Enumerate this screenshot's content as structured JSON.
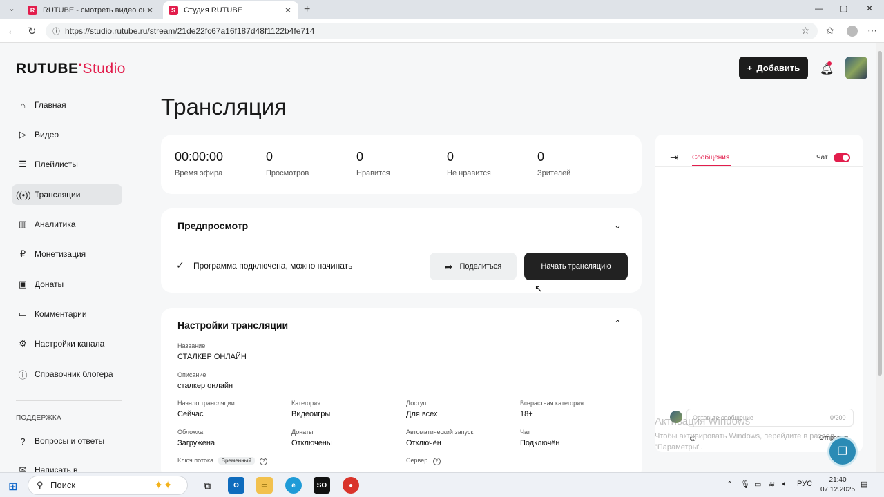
{
  "browser": {
    "tabs": [
      {
        "title": "RUTUBE - смотреть видео онлай",
        "icon": "rutube-favicon"
      },
      {
        "title": "Студия RUTUBE",
        "icon": "rutube-studio-favicon"
      }
    ],
    "url": "https://studio.rutube.ru/stream/21de22fc67a16f187d48f1122b4fe714"
  },
  "header": {
    "logo_main": "RUTUBE",
    "logo_accent": "Studio",
    "add_button": "Добавить"
  },
  "sidebar": {
    "items": [
      {
        "label": "Главная",
        "icon": "home-icon"
      },
      {
        "label": "Видео",
        "icon": "video-icon"
      },
      {
        "label": "Плейлисты",
        "icon": "playlist-icon"
      },
      {
        "label": "Трансляции",
        "icon": "broadcast-icon",
        "active": true
      },
      {
        "label": "Аналитика",
        "icon": "analytics-icon"
      },
      {
        "label": "Монетизация",
        "icon": "money-icon"
      },
      {
        "label": "Донаты",
        "icon": "wallet-icon"
      },
      {
        "label": "Комментарии",
        "icon": "comment-icon"
      },
      {
        "label": "Настройки канала",
        "icon": "gear-icon"
      },
      {
        "label": "Справочник блогера",
        "icon": "info-icon"
      }
    ],
    "support_heading": "ПОДДЕРЖКА",
    "support_items": [
      {
        "label": "Вопросы и ответы",
        "icon": "question-icon"
      },
      {
        "label": "Написать в",
        "icon": "chat-icon"
      }
    ]
  },
  "main": {
    "title": "Трансляция",
    "stats": [
      {
        "value": "00:00:00",
        "label": "Время эфира"
      },
      {
        "value": "0",
        "label": "Просмотров"
      },
      {
        "value": "0",
        "label": "Нравится"
      },
      {
        "value": "0",
        "label": "Не нравится"
      },
      {
        "value": "0",
        "label": "Зрителей"
      }
    ],
    "preview": {
      "title": "Предпросмотр",
      "status": "Программа подключена, можно начинать",
      "share_button": "Поделиться",
      "start_button": "Начать трансляцию"
    },
    "settings": {
      "title": "Настройки трансляции",
      "name_label": "Название",
      "name_value": "СТАЛКЕР ОНЛАЙН",
      "desc_label": "Описание",
      "desc_value": "сталкер онлайн",
      "fields": [
        {
          "label": "Начало трансляции",
          "value": "Сейчас"
        },
        {
          "label": "Категория",
          "value": "Видеоигры"
        },
        {
          "label": "Доступ",
          "value": "Для всех"
        },
        {
          "label": "Возрастная категория",
          "value": "18+"
        },
        {
          "label": "Обложка",
          "value": "Загружена"
        },
        {
          "label": "Донаты",
          "value": "Отключены"
        },
        {
          "label": "Автоматический запуск",
          "value": "Отключён"
        },
        {
          "label": "Чат",
          "value": "Подключён"
        }
      ],
      "stream_key_label": "Ключ потока",
      "stream_key_badge": "Временный",
      "server_label": "Сервер"
    }
  },
  "chat": {
    "tab": "Сообщения",
    "toggle_label": "Чат",
    "toggle_on": true,
    "input_placeholder": "Оставьте сообщение",
    "counter": "0/200",
    "send": "Отправить"
  },
  "watermark": {
    "line1": "Активация Windows",
    "line2": "Чтобы активировать Windows, перейдите в раздел \"Параметры\"."
  },
  "taskbar": {
    "search": "Поиск",
    "lang": "РУС",
    "time": "21:40",
    "date": "07.12.2025"
  }
}
